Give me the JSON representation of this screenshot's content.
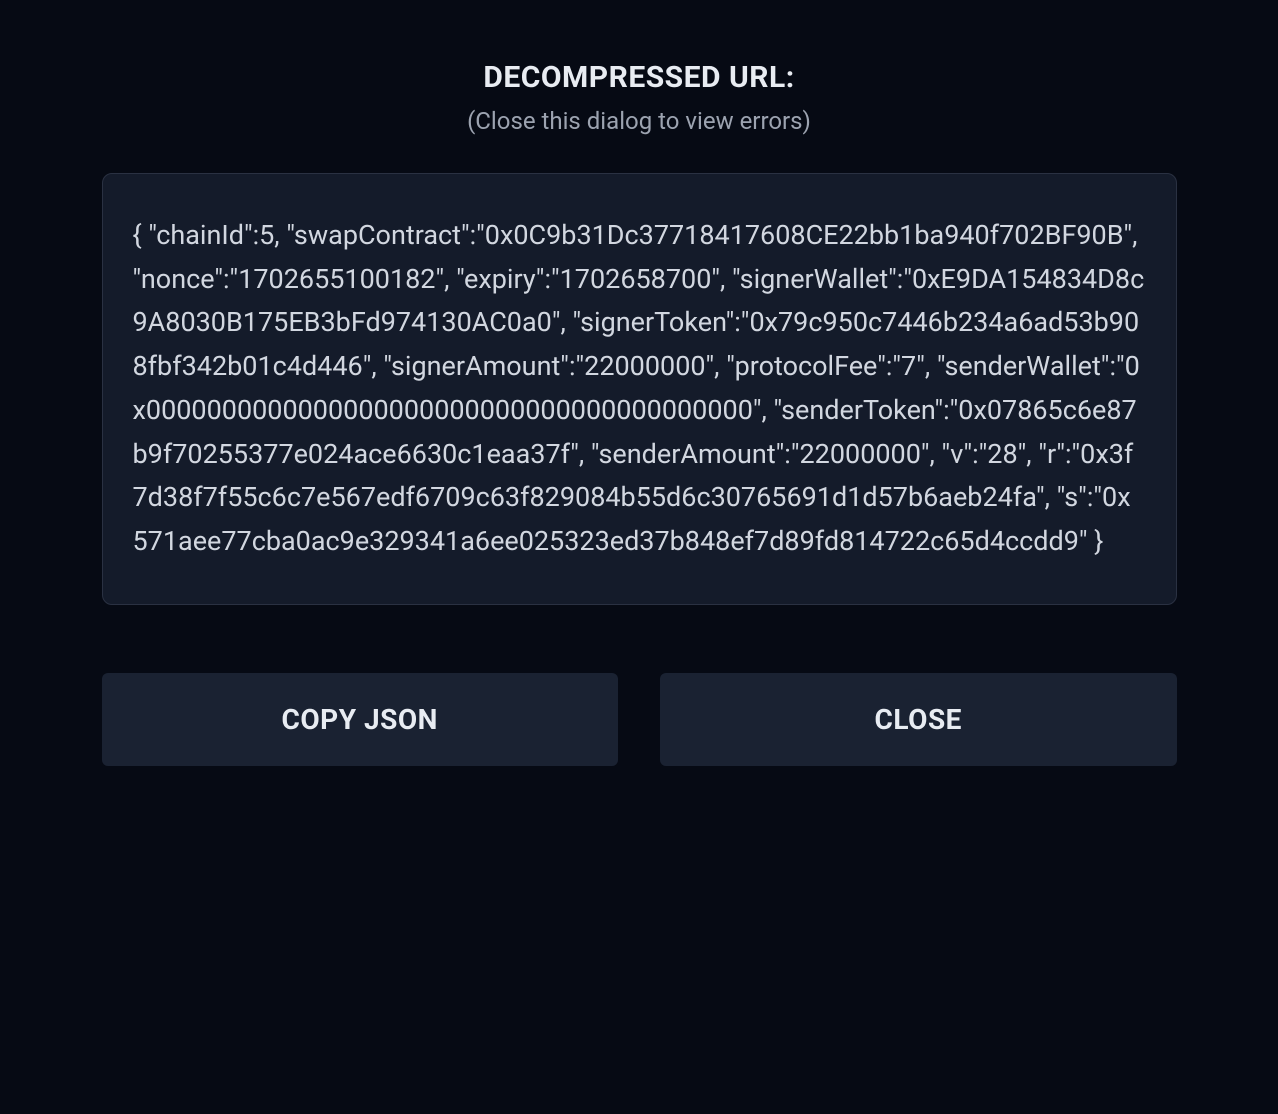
{
  "dialog": {
    "title": "DECOMPRESSED URL:",
    "subtitle": "(Close this dialog to view errors)",
    "content": "{ \"chainId\":5, \"swapContract\":\"0x0C9b31Dc37718417608CE22bb1ba940f702BF90B\", \"nonce\":\"1702655100182\", \"expiry\":\"1702658700\", \"signerWallet\":\"0xE9DA154834D8c9A8030B175EB3bFd974130AC0a0\", \"signerToken\":\"0x79c950c7446b234a6ad53b908fbf342b01c4d446\", \"signerAmount\":\"22000000\", \"protocolFee\":\"7\", \"senderWallet\":\"0x0000000000000000000000000000000000000000\", \"senderToken\":\"0x07865c6e87b9f70255377e024ace6630c1eaa37f\", \"senderAmount\":\"22000000\", \"v\":\"28\", \"r\":\"0x3f7d38f7f55c6c7e567edf6709c63f829084b55d6c30765691d1d57b6aeb24fa\", \"s\":\"0x571aee77cba0ac9e329341a6ee025323ed37b848ef7d89fd814722c65d4ccdd9\" }",
    "buttons": {
      "copy": "COPY JSON",
      "close": "CLOSE"
    }
  }
}
